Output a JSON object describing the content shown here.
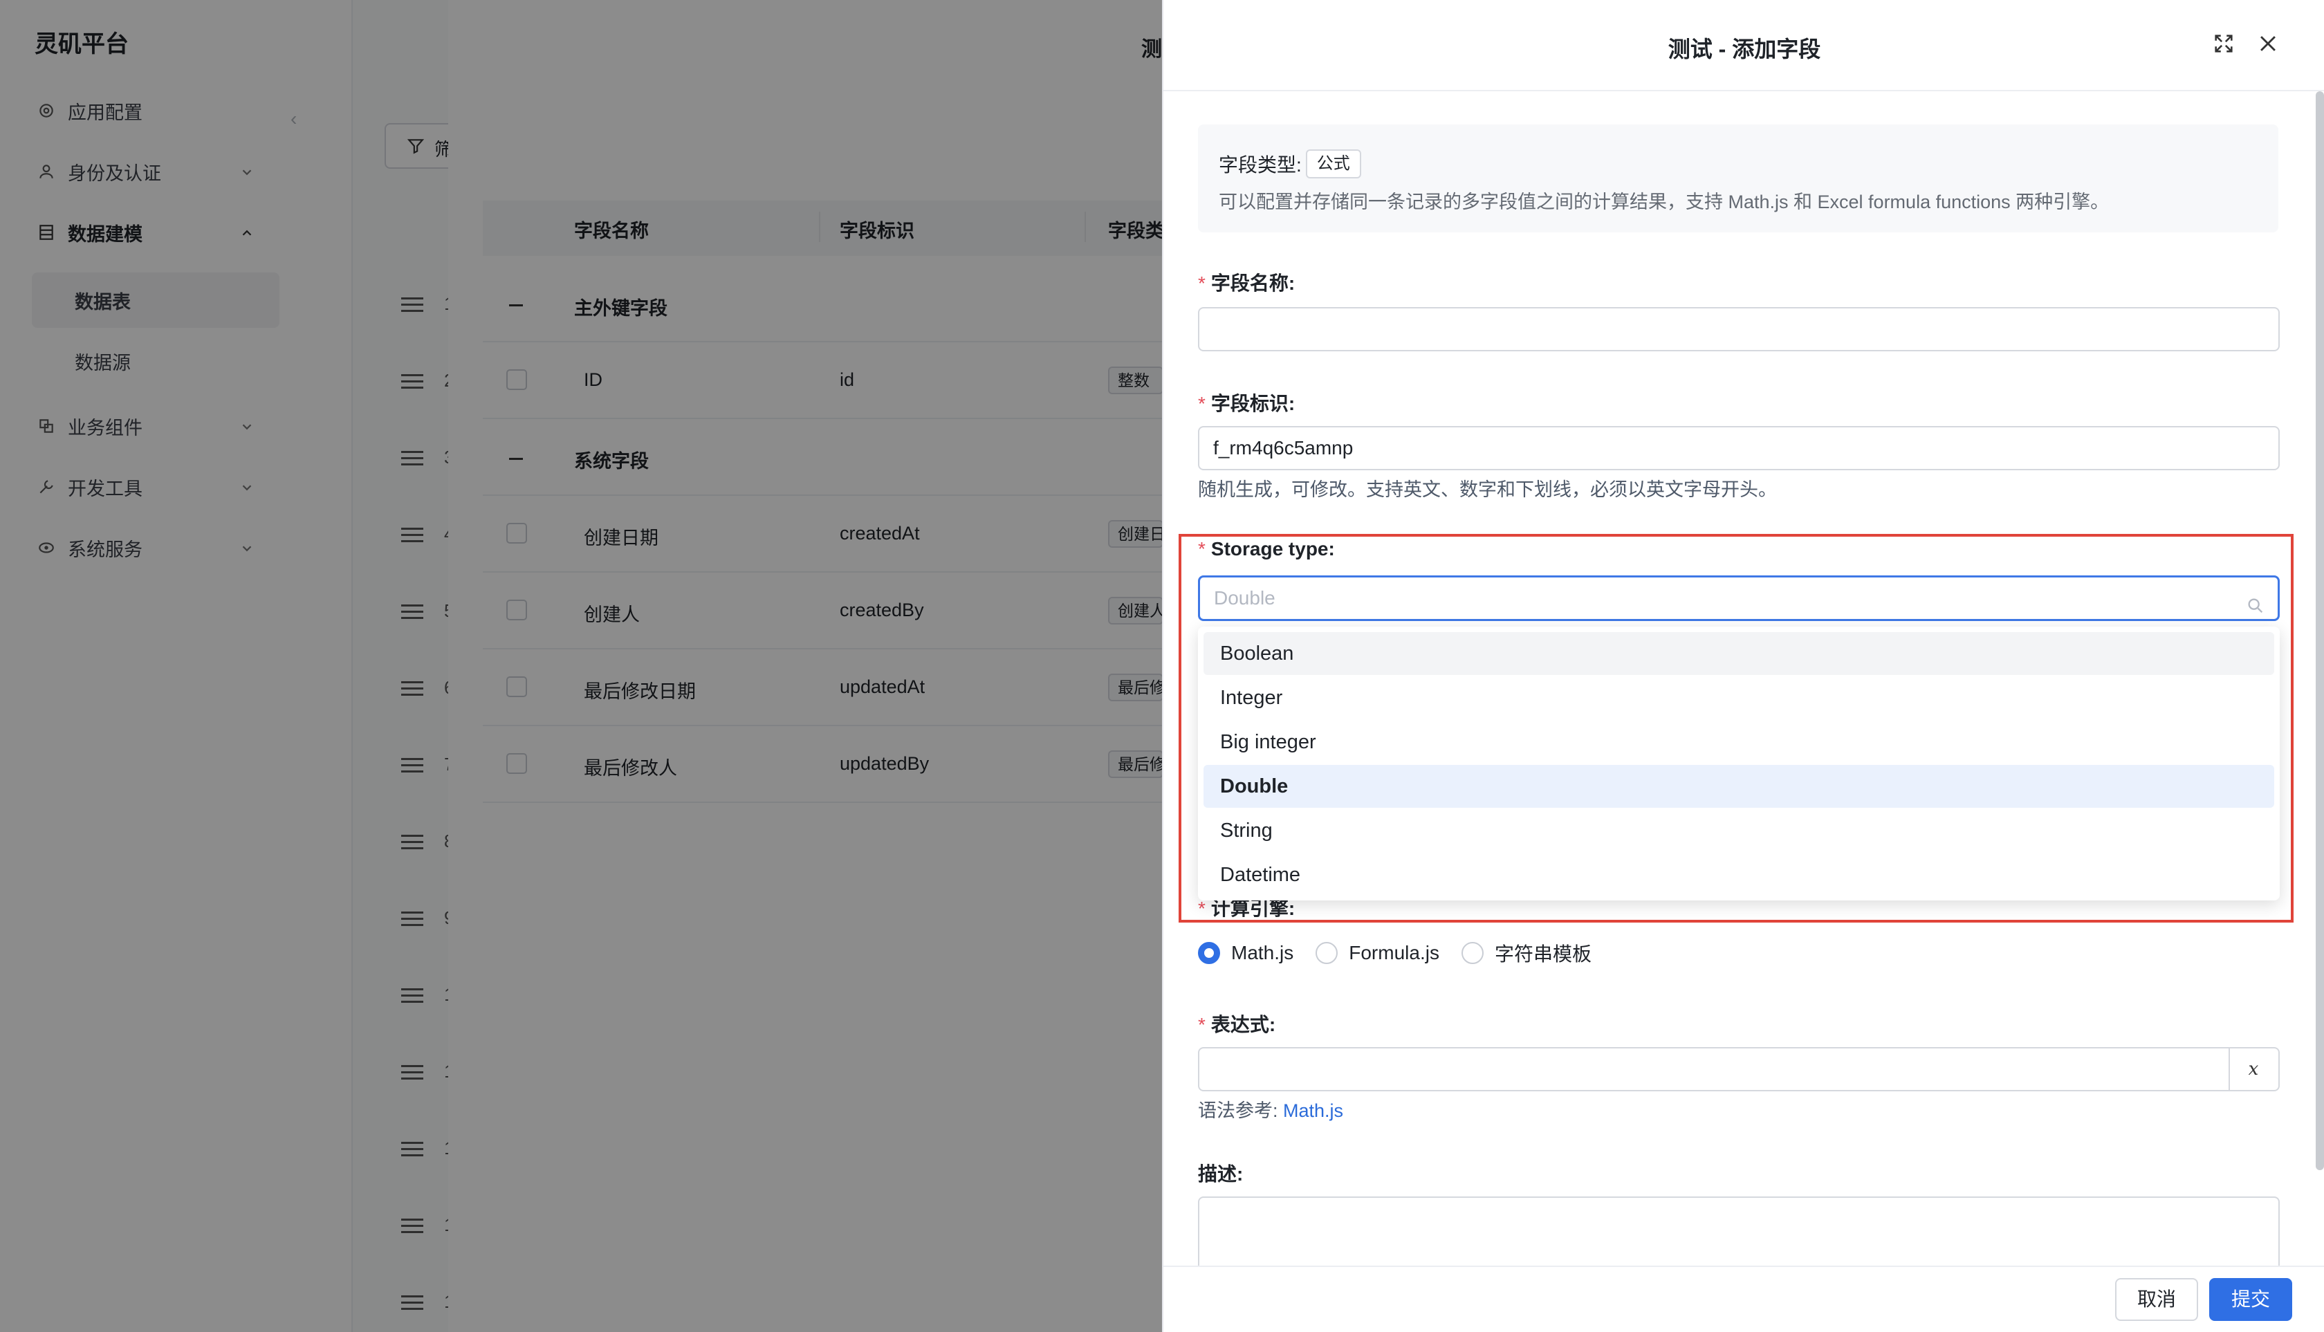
{
  "app": {
    "logo": "灵矶平台",
    "sidebar": {
      "items": [
        {
          "label": "应用配置",
          "icon": "gear-icon"
        },
        {
          "label": "身份及认证",
          "icon": "user-icon"
        },
        {
          "label": "数据建模",
          "icon": "table-icon"
        },
        {
          "label": "业务组件",
          "icon": "components-icon"
        },
        {
          "label": "开发工具",
          "icon": "wrench-icon"
        },
        {
          "label": "系统服务",
          "icon": "service-icon"
        }
      ],
      "sub_items": [
        {
          "label": "数据表",
          "active": true
        },
        {
          "label": "数据源",
          "active": false
        }
      ]
    }
  },
  "background_modal": {
    "title_fragment": "测",
    "filter_fragment": "筛",
    "columns": [
      "字段名称",
      "字段标识",
      "字段类"
    ],
    "groups": [
      {
        "label": "主外键字段",
        "rows": [
          {
            "name": "ID",
            "key": "id",
            "type": "整数"
          }
        ]
      },
      {
        "label": "系统字段",
        "rows": [
          {
            "name": "创建日期",
            "key": "createdAt",
            "type": "创建日"
          },
          {
            "name": "创建人",
            "key": "createdBy",
            "type": "创建人"
          },
          {
            "name": "最后修改日期",
            "key": "updatedAt",
            "type": "最后修"
          },
          {
            "name": "最后修改人",
            "key": "updatedBy",
            "type": "最后修"
          }
        ]
      }
    ],
    "row_numbers": [
      "1",
      "2",
      "3",
      "4",
      "5",
      "6",
      "7",
      "8",
      "9",
      "1",
      "1",
      "1",
      "1",
      "1"
    ]
  },
  "drawer": {
    "title": "测试 - 添加字段",
    "field_type_label": "字段类型:",
    "field_type_value": "公式",
    "field_type_desc": "可以配置并存储同一条记录的多字段值之间的计算结果，支持 Math.js 和 Excel formula functions 两种引擎。",
    "field_name": {
      "label": "字段名称:",
      "value": ""
    },
    "field_key": {
      "label": "字段标识:",
      "value": "f_rm4q6c5amnp",
      "help": "随机生成，可修改。支持英文、数字和下划线，必须以英文字母开头。"
    },
    "storage_type": {
      "label": "Storage type:",
      "placeholder": "Double",
      "selected": "Double",
      "hovered": "Boolean",
      "options": [
        "Boolean",
        "Integer",
        "Big integer",
        "Double",
        "String",
        "Datetime"
      ]
    },
    "engine": {
      "label": "计算引擎:",
      "options": [
        "Math.js",
        "Formula.js",
        "字符串模板"
      ],
      "selected": "Math.js"
    },
    "expression": {
      "label": "表达式:",
      "value": "",
      "x_button": "x",
      "help_prefix": "语法参考:",
      "help_link": "Math.js"
    },
    "description": {
      "label": "描述:"
    },
    "buttons": {
      "cancel": "取消",
      "submit": "提交"
    }
  },
  "colors": {
    "accent": "#2f6fe4",
    "highlight_frame": "#e0443a",
    "required": "#e34d59"
  }
}
